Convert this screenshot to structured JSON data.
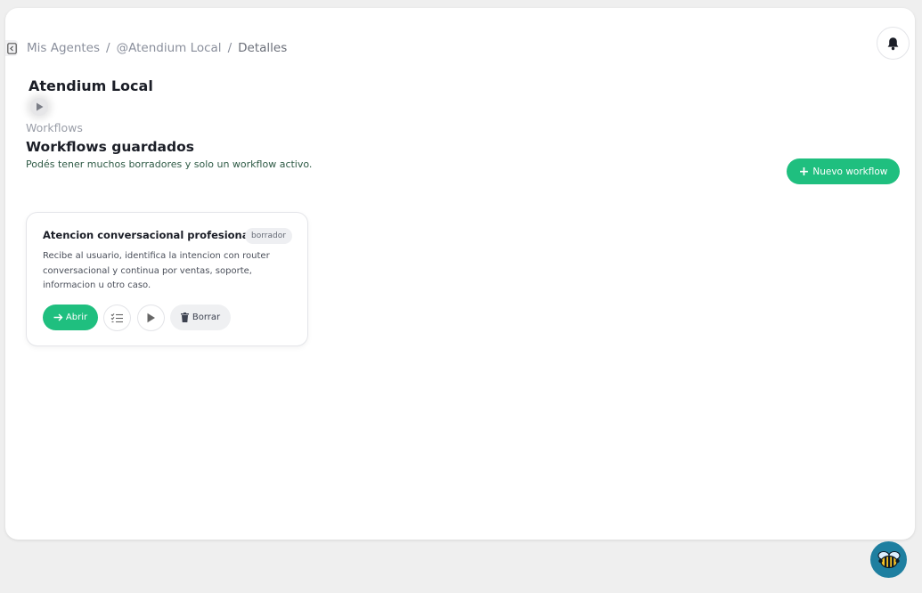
{
  "breadcrumb": {
    "items": [
      "Mis Agentes",
      "@Atendium Local",
      "Detalles"
    ],
    "separator": "/"
  },
  "agent": {
    "name": "Atendium Local"
  },
  "section": {
    "label": "Workflows",
    "title": "Workflows guardados",
    "subtitle": "Podés tener muchos borradores y solo un workflow activo."
  },
  "toolbar": {
    "new_workflow_label": "Nuevo workflow",
    "new_workflow_icon": "plus-icon"
  },
  "workflows": [
    {
      "title": "Atencion conversacional profesional",
      "status": "borrador",
      "description": "Recibe al usuario, identifica la intencion con router conversacional y continua por ventas, soporte, informacion u otro caso.",
      "open_label": "Abrir",
      "delete_label": "Borrar"
    }
  ],
  "colors": {
    "accent": "#1fbf7f",
    "bee_button": "#1e7fa0",
    "page_bg": "#efefef",
    "panel_bg": "#ffffff"
  },
  "icons": {
    "collapse": "collapse-sidebar-icon",
    "bell": "bell-icon",
    "play": "play-icon",
    "arrow": "arrow-right-icon",
    "checklist": "checklist-icon",
    "trash": "trash-icon",
    "bee": "bee-icon"
  }
}
